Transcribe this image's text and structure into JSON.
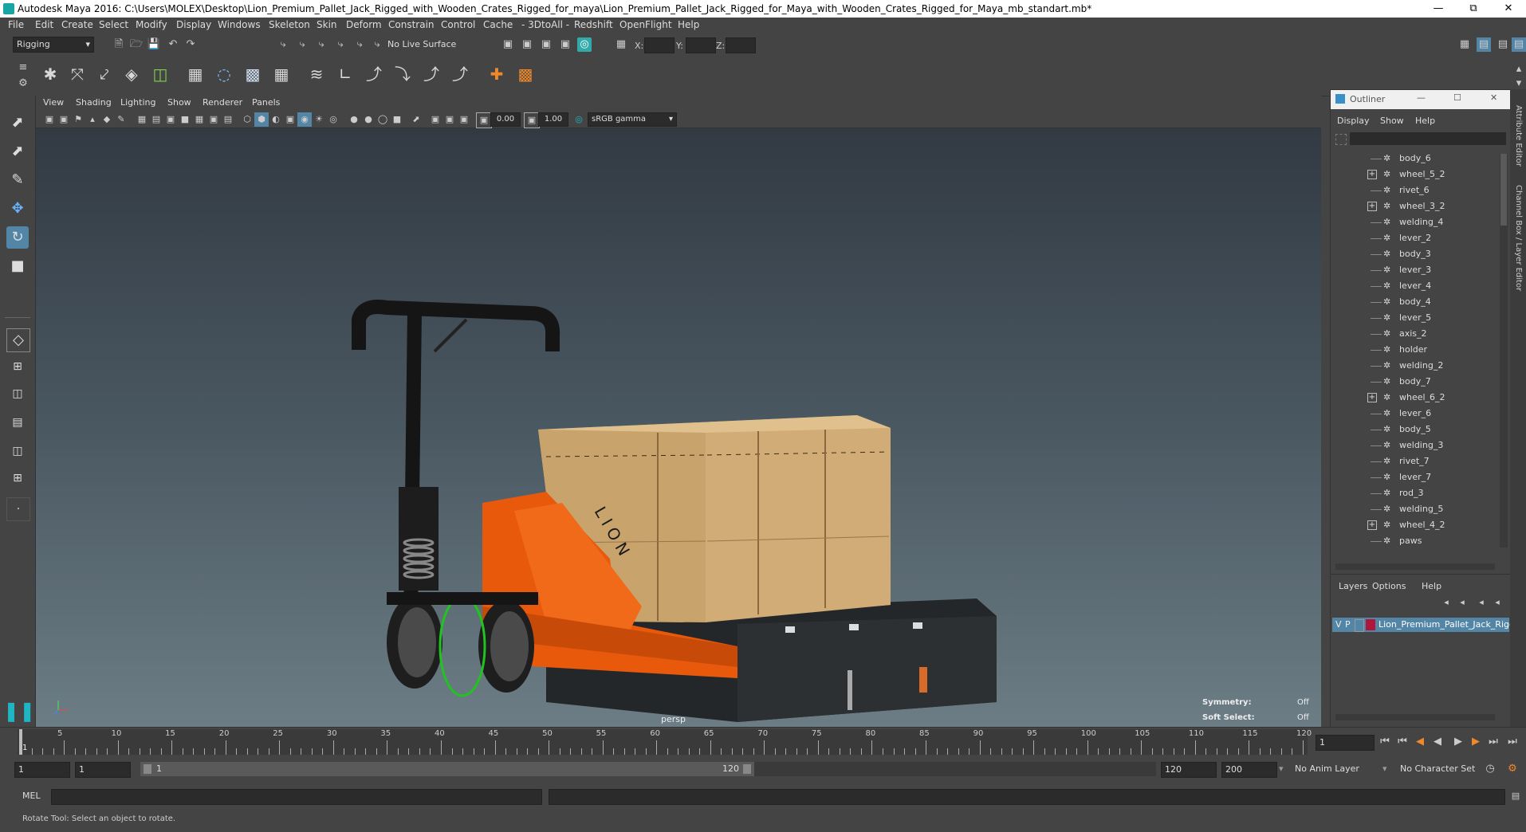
{
  "window": {
    "title": "Autodesk Maya 2016: C:\\Users\\MOLEX\\Desktop\\Lion_Premium_Pallet_Jack_Rigged_with_Wooden_Crates_Rigged_for_maya\\Lion_Premium_Pallet_Jack_Rigged_for_Maya_with_Wooden_Crates_Rigged_for_Maya_mb_standart.mb*",
    "minimize": "—",
    "maximize": "⧉",
    "close": "✕"
  },
  "menubar": [
    "File",
    "Edit",
    "Create",
    "Select",
    "Modify",
    "Display",
    "Windows",
    "Skeleton",
    "Skin",
    "Deform",
    "Constrain",
    "Control",
    "Cache",
    "- 3DtoAll -",
    "Redshift",
    "OpenFlight",
    "Help"
  ],
  "statusline": {
    "mode": "Rigging",
    "live_surface": "No Live Surface",
    "x_label": "X:",
    "y_label": "Y:",
    "z_label": "Z:"
  },
  "panel": {
    "menus": [
      "View",
      "Shading",
      "Lighting",
      "Show",
      "Renderer",
      "Panels"
    ],
    "exposure": "0.00",
    "gamma": "1.00",
    "color_space": "sRGB gamma",
    "camera": "persp",
    "symmetry_label": "Symmetry:",
    "symmetry_value": "Off",
    "soft_select_label": "Soft Select:",
    "soft_select_value": "Off",
    "crate_marks": "L I O N"
  },
  "outliner": {
    "title": "Outliner",
    "menus": [
      "Display",
      "Show",
      "Help"
    ],
    "items": [
      {
        "name": "body_6",
        "expandable": false
      },
      {
        "name": "wheel_5_2",
        "expandable": true
      },
      {
        "name": "rivet_6",
        "expandable": false
      },
      {
        "name": "wheel_3_2",
        "expandable": true
      },
      {
        "name": "welding_4",
        "expandable": false
      },
      {
        "name": "lever_2",
        "expandable": false
      },
      {
        "name": "body_3",
        "expandable": false
      },
      {
        "name": "lever_3",
        "expandable": false
      },
      {
        "name": "lever_4",
        "expandable": false
      },
      {
        "name": "body_4",
        "expandable": false
      },
      {
        "name": "lever_5",
        "expandable": false
      },
      {
        "name": "axis_2",
        "expandable": false
      },
      {
        "name": "holder",
        "expandable": false
      },
      {
        "name": "welding_2",
        "expandable": false
      },
      {
        "name": "body_7",
        "expandable": false
      },
      {
        "name": "wheel_6_2",
        "expandable": true
      },
      {
        "name": "lever_6",
        "expandable": false
      },
      {
        "name": "body_5",
        "expandable": false
      },
      {
        "name": "welding_3",
        "expandable": false
      },
      {
        "name": "rivet_7",
        "expandable": false
      },
      {
        "name": "lever_7",
        "expandable": false
      },
      {
        "name": "rod_3",
        "expandable": false
      },
      {
        "name": "welding_5",
        "expandable": false
      },
      {
        "name": "wheel_4_2",
        "expandable": true
      },
      {
        "name": "paws",
        "expandable": false
      }
    ]
  },
  "layers": {
    "menus": [
      "Layers",
      "Options",
      "Help"
    ],
    "v": "V",
    "p": "P",
    "layer_name": "Lion_Premium_Pallet_Jack_Rigge",
    "layer_color": "#b0153a"
  },
  "side_tabs": {
    "attribute_editor": "Attribute Editor",
    "channel_box": "Channel Box / Layer Editor"
  },
  "timeline": {
    "ticks": [
      "5",
      "10",
      "15",
      "20",
      "25",
      "30",
      "35",
      "40",
      "45",
      "50",
      "55",
      "60",
      "65",
      "70",
      "75",
      "80",
      "85",
      "90",
      "95",
      "100",
      "105",
      "110",
      "115",
      "120"
    ],
    "start_tick": "1",
    "current_frame": "1"
  },
  "range": {
    "start": "1",
    "playback_start": "1",
    "slider_start": "1",
    "slider_end": "120",
    "playback_end": "120",
    "end": "200",
    "anim_layer": "No Anim Layer",
    "character_set": "No Character Set"
  },
  "cmdline": {
    "label": "MEL"
  },
  "helpline": {
    "text": "Rotate Tool: Select an object to rotate."
  },
  "colors": {
    "jack_orange": "#e8590c",
    "wheel_green": "#21c321",
    "crate_wood": "#c9a36c",
    "pallet": "#222528"
  }
}
